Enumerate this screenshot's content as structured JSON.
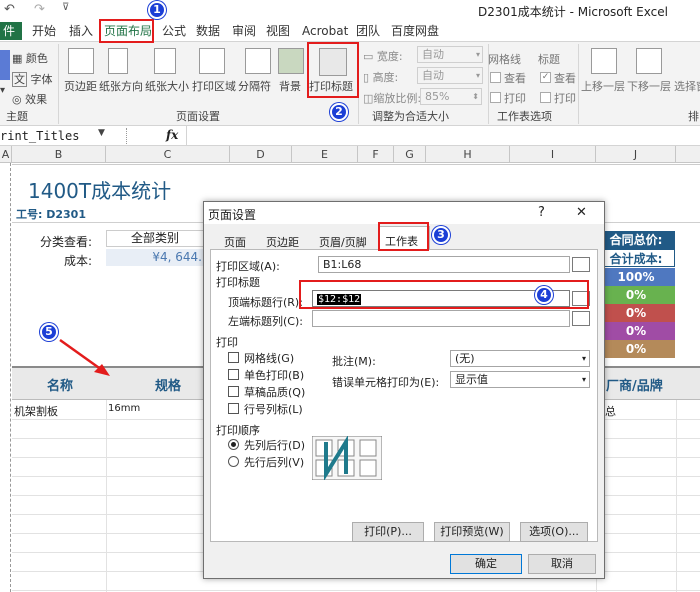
{
  "app": {
    "title": "D2301成本统计 - Microsoft Excel",
    "qat_more": "⊽"
  },
  "tabs": {
    "file": "件",
    "home": "开始",
    "insert": "插入",
    "page_layout": "页面布局",
    "formulas": "公式",
    "data": "数据",
    "review": "审阅",
    "view": "视图",
    "acrobat": "Acrobat",
    "team": "团队",
    "baidu": "百度网盘"
  },
  "ribbon": {
    "themes_group": "主题",
    "colors": "颜色",
    "fonts": "字体",
    "effects": "效果",
    "margins": "页边距",
    "orientation": "纸张方向",
    "size": "纸张大小",
    "print_area": "打印区域",
    "breaks": "分隔符",
    "background": "背景",
    "print_titles": "打印标题",
    "page_setup_group": "页面设置",
    "width_label": "宽度:",
    "width_value": "自动",
    "height_label": "高度:",
    "height_value": "自动",
    "scale_label": "缩放比例:",
    "scale_value": "85%",
    "scale_fit_group": "调整为合适大小",
    "gridlines": "网格线",
    "headings": "标题",
    "view1": "查看",
    "view2": "查看",
    "print1": "打印",
    "print2": "打印",
    "sheet_options_group": "工作表选项",
    "bring_forward": "上移一层",
    "send_backward": "下移一层",
    "selection_pane": "选择窗",
    "arrange_group": "排"
  },
  "formula_bar": {
    "name_box": "rint_Titles",
    "fx": "fx"
  },
  "columns": [
    "A",
    "B",
    "C",
    "D",
    "E",
    "F",
    "G",
    "H",
    "I",
    "J"
  ],
  "sheet": {
    "title": "1400T成本统计",
    "job_no": "工号: D2301",
    "filter_label": "分类查看:",
    "filter_value": "全部类别",
    "cost_label": "成本:",
    "cost_value": "¥4, 644.",
    "contract_total": "合同总价:",
    "total_cost": "合计成本:",
    "pct": [
      "100%",
      "0%",
      "0%",
      "0%",
      "0%"
    ],
    "header_name": "名称",
    "header_spec": "规格",
    "header_vendor": "厂商/品牌",
    "row1_name": "机架割板",
    "row1_spec": "16mm",
    "row1_vendor": "总"
  },
  "dialog": {
    "title": "页面设置",
    "help": "?",
    "close": "✕",
    "tabs": [
      "页面",
      "页边距",
      "页眉/页脚",
      "工作表"
    ],
    "print_area_label": "打印区域(A):",
    "print_area_value": "B1:L68",
    "print_titles_section": "打印标题",
    "rows_to_repeat_label": "顶端标题行(R):",
    "rows_to_repeat_value": "$12:$12",
    "cols_to_repeat_label": "左端标题列(C):",
    "cols_to_repeat_value": "",
    "print_section": "打印",
    "gridlines": "网格线(G)",
    "black_white": "单色打印(B)",
    "draft": "草稿品质(Q)",
    "row_col_headings": "行号列标(L)",
    "comments_label": "批注(M):",
    "comments_value": "(无)",
    "errors_label": "错误单元格打印为(E):",
    "errors_value": "显示值",
    "page_order_section": "打印顺序",
    "down_then_over": "先列后行(D)",
    "over_then_down": "先行后列(V)",
    "print_btn": "打印(P)...",
    "preview_btn": "打印预览(W)",
    "options_btn": "选项(O)...",
    "ok_btn": "确定",
    "cancel_btn": "取消"
  },
  "badges": [
    "1",
    "2",
    "3",
    "4",
    "5"
  ],
  "colors": {
    "excel_green": "#217346",
    "header_blue": "#215a86",
    "pct_blue": "#4f78c0",
    "pct_green": "#68b24f",
    "pct_red": "#c0504d",
    "pct_purple": "#a04ca5",
    "pct_brown": "#b48a5a",
    "callout_red": "#e31c1c",
    "badge_blue": "#1c3fd6"
  }
}
